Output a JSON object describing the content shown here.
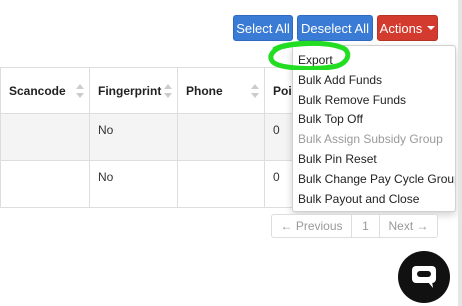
{
  "toolbar": {
    "select_all": "Select All",
    "deselect_all": "Deselect All",
    "actions": "Actions"
  },
  "table": {
    "columns": [
      "Scancode",
      "Fingerprint",
      "Phone",
      "Poin"
    ],
    "rows": [
      {
        "scancode": "",
        "fingerprint": "No",
        "phone": "",
        "points": "0"
      },
      {
        "scancode": "",
        "fingerprint": "No",
        "phone": "",
        "points": "0"
      }
    ]
  },
  "actions_menu": {
    "items": [
      {
        "label": "Export",
        "enabled": true
      },
      {
        "label": "Bulk Add Funds",
        "enabled": true
      },
      {
        "label": "Bulk Remove Funds",
        "enabled": true
      },
      {
        "label": "Bulk Top Off",
        "enabled": true
      },
      {
        "label": "Bulk Assign Subsidy Group",
        "enabled": false
      },
      {
        "label": "Bulk Pin Reset",
        "enabled": true
      },
      {
        "label": "Bulk Change Pay Cycle Group",
        "enabled": true
      },
      {
        "label": "Bulk Payout and Close",
        "enabled": true
      }
    ]
  },
  "pagination": {
    "previous": "← Previous",
    "page": "1",
    "next": "Next →"
  },
  "colors": {
    "primary": "#3a7bd5",
    "danger": "#d43b2f",
    "highlight": "#22dd22"
  },
  "icons": {
    "chat": "chat-bubble-icon",
    "sort": "sort-icon"
  }
}
